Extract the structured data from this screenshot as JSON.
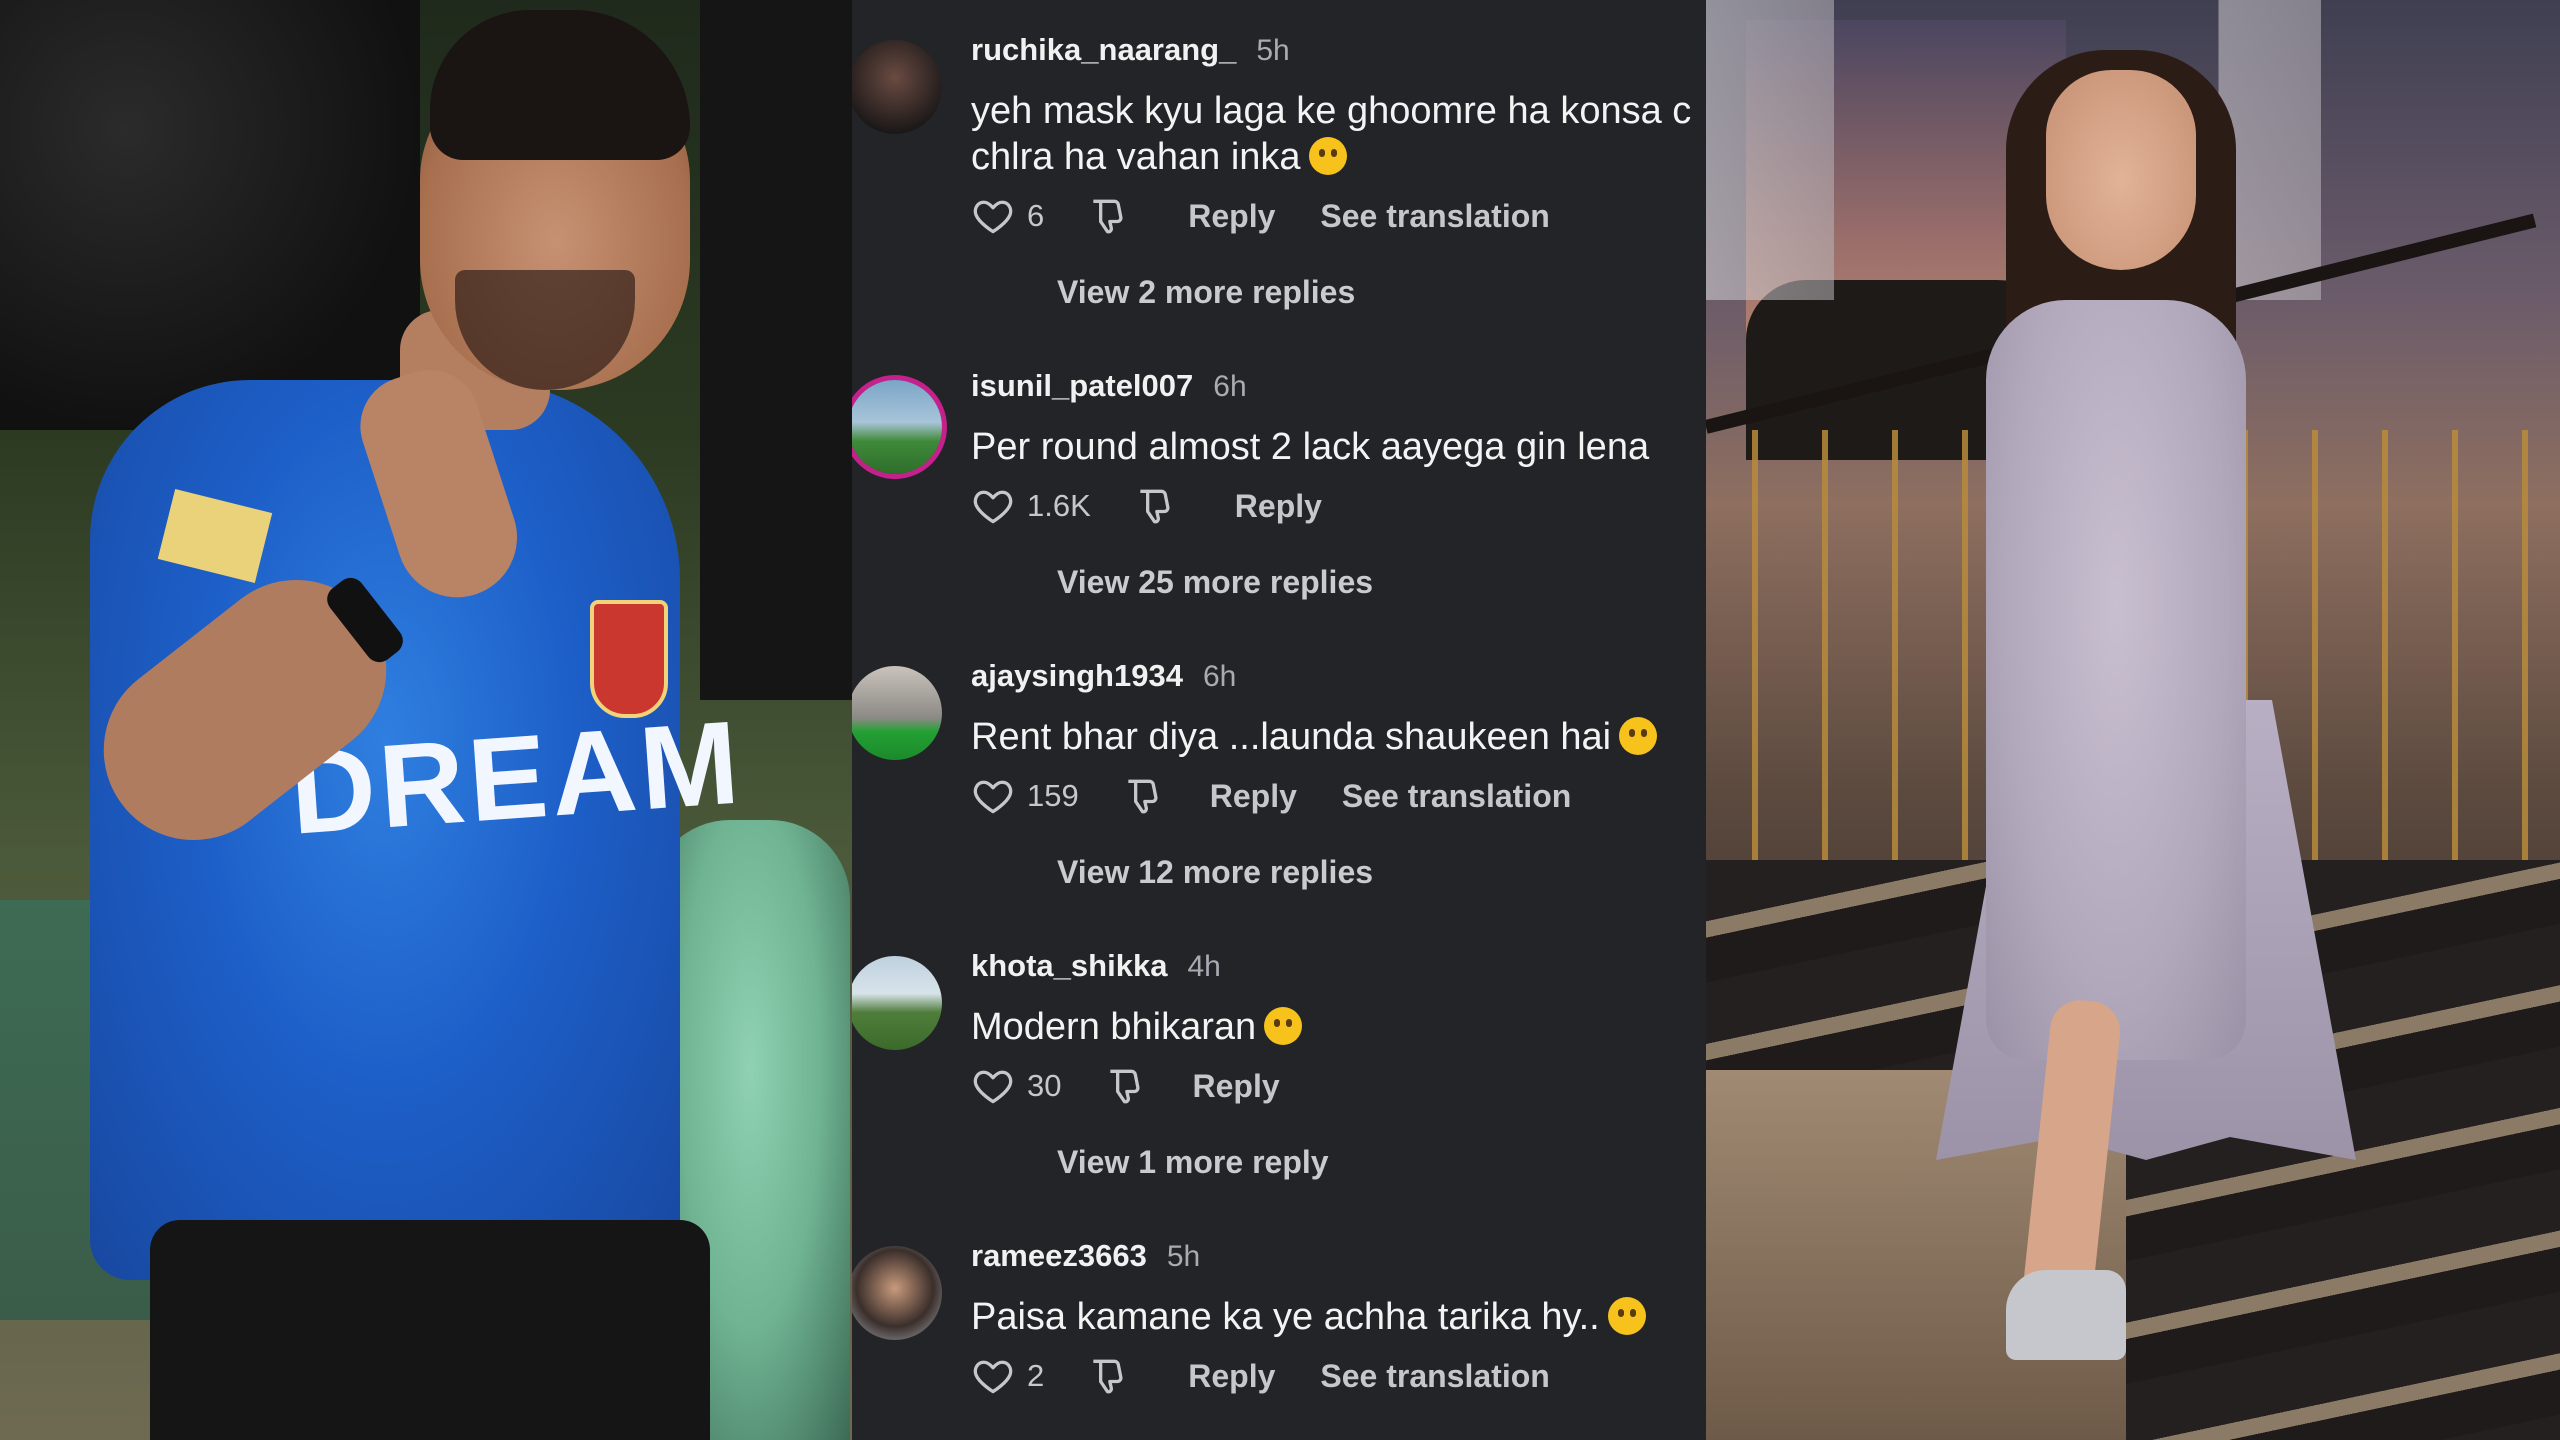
{
  "left_photo": {
    "jersey_text": "DREAM"
  },
  "comments": [
    {
      "username": "ruchika_naarang_",
      "time": "5h",
      "text": "yeh mask kyu laga ke ghoomre ha konsa c",
      "text_line2": "chlra ha vahan inka",
      "emoji": "thinking-face",
      "likes": "6",
      "reply_label": "Reply",
      "translation_label": "See translation",
      "view_more": "View 2 more replies",
      "avatar_colors": [
        "#6a4b42",
        "#1b1818"
      ]
    },
    {
      "username": "isunil_patel007",
      "time": "6h",
      "text": "Per round almost 2 lack aayega gin lena",
      "likes": "1.6K",
      "reply_label": "Reply",
      "view_more": "View 25 more replies",
      "avatar_colors": [
        "#7aa5c8",
        "#3f8a3a"
      ]
    },
    {
      "username": "ajaysingh1934",
      "time": "6h",
      "text": "Rent bhar diya ...launda shaukeen hai",
      "emoji": "grinning-sweat-face",
      "likes": "159",
      "reply_label": "Reply",
      "translation_label": "See translation",
      "view_more": "View 12 more replies",
      "avatar_colors": [
        "#c9c3bb",
        "#23a034"
      ]
    },
    {
      "username": "khota_shikka",
      "time": "4h",
      "text": "Modern bhikaran",
      "emoji": "astonished-face",
      "likes": "30",
      "reply_label": "Reply",
      "view_more": "View 1 more reply",
      "avatar_colors": [
        "#bfd1df",
        "#4f7d3a"
      ]
    },
    {
      "username": "rameez3663",
      "time": "5h",
      "text": "Paisa kamane ka ye achha tarika hy..",
      "emoji": "face-with-tears-of-joy",
      "likes": "2",
      "reply_label": "Reply",
      "translation_label": "See translation",
      "avatar_colors": [
        "#a9b0b8",
        "#3b2f2b"
      ]
    }
  ],
  "icons": {
    "like": "heart-outline-icon",
    "dislike": "thumbs-down-outline-icon"
  },
  "colors": {
    "panel_bg": "#232427",
    "text": "#f3f3f3",
    "muted": "#a8abb2",
    "story_ring": "#c5208c"
  }
}
